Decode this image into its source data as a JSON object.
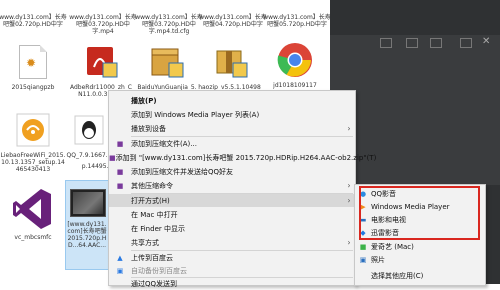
{
  "files_top": [
    {
      "name": "www.dy131.com】长寿吧蟹02.720p.HD中字"
    },
    {
      "name": "www.dy131.com】长寿吧蟹03.720p.HD中字.mp4"
    },
    {
      "name": "www.dy131.com】长寿吧蟹03.720p.HD中字.mp4.td.cfg"
    },
    {
      "name": "www.dy131.com】长寿吧蟹04.720p.HD中字"
    },
    {
      "name": "www.dy131.com】长寿吧蟹05.720p.HD中字"
    }
  ],
  "files_row2": [
    {
      "name": "2015qiangpzb"
    },
    {
      "name": "AdbeRdr11000_zh_CN11.0.0.379_..."
    },
    {
      "name": "BaiduYunGuanjia_5.5..."
    },
    {
      "name": "haozip_v5.5.1.10498_i..."
    },
    {
      "name": "jd1018109117"
    }
  ],
  "files_row3": [
    {
      "name": "LiebaoFreeWiFi_2015.10.13.1357_setup.14465430413"
    },
    {
      "name": "QQ_7.9.1667..."
    },
    {
      "name": "p.14495..."
    }
  ],
  "files_row4": [
    {
      "name": "vc_mbcsmfc"
    },
    {
      "name": "[www.dy131.com]长寿吧蟹 2015.720p.HD...64.AAC..."
    }
  ],
  "context_menu": {
    "items": [
      {
        "label": "播放(P)",
        "bold": true
      },
      {
        "label": "添加到 Windows Media Player 列表(A)"
      },
      {
        "label": "播放到设备"
      },
      {
        "label": "添加到压缩文件(A)..."
      },
      {
        "label": "添加到 \"[www.dy131.com]长寿吧蟹 2015.720p.HDRip.H264.AAC-ob2.zip\"(T)"
      },
      {
        "label": "添加到压缩文件并发送给QQ好友"
      },
      {
        "label": "其他压缩命令"
      },
      {
        "label": "打开方式(H)"
      },
      {
        "label": "在 Mac 中打开"
      },
      {
        "label": "在 Finder 中显示"
      },
      {
        "label": "共享方式"
      },
      {
        "label": "上传到百度云"
      },
      {
        "label": "自动备份到百度云"
      },
      {
        "label": "通过QQ发送到"
      }
    ]
  },
  "submenu": {
    "items": [
      {
        "label": "QQ影音"
      },
      {
        "label": "Windows Media Player"
      },
      {
        "label": "电影和电视"
      },
      {
        "label": "迅雷影音"
      },
      {
        "label": "爱奇艺 (Mac)"
      },
      {
        "label": "照片"
      },
      {
        "label": "选择其他应用(C)"
      }
    ]
  },
  "colors": {
    "highlight_box": "#d9271f",
    "selection": "#cce4f7",
    "chrome_red": "#db4437",
    "chrome_yellow": "#f4c20d",
    "chrome_green": "#3cba54",
    "chrome_blue": "#4885ed",
    "vs_purple": "#68217a"
  }
}
